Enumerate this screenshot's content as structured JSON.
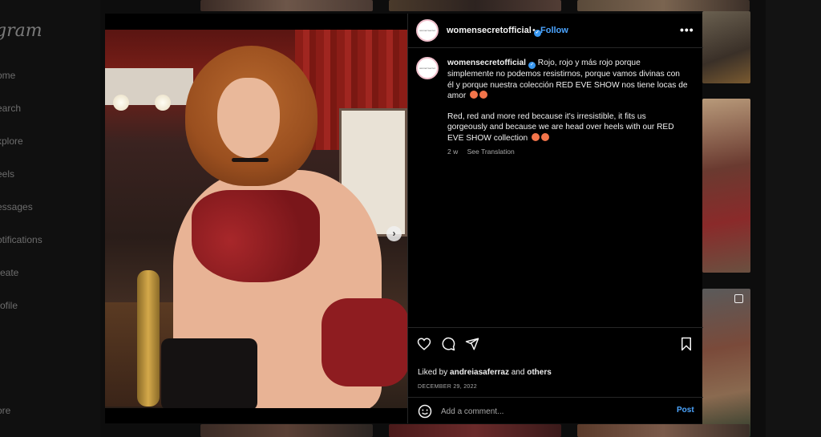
{
  "sidebar": {
    "brand": "gram",
    "items": [
      {
        "label": "ome"
      },
      {
        "label": "earch"
      },
      {
        "label": "xplore"
      },
      {
        "label": "eels"
      },
      {
        "label": "essages"
      },
      {
        "label": "otifications"
      },
      {
        "label": "reate"
      },
      {
        "label": "rofile"
      },
      {
        "label": "ore"
      }
    ]
  },
  "post": {
    "username": "womensecretofficial",
    "avatar_text": "women'secret",
    "separator": "•",
    "follow_label": "Follow",
    "more_label": "•••",
    "caption_es": "Rojo, rojo y más rojo porque simplemente no podemos resistirnos, porque vamos divinas con él y porque nuestra colección RED EVE SHOW nos tiene locas de amor",
    "caption_en": "Red, red and more red because it's irresistible, it fits us gorgeously and because we are head over heels with our RED EVE SHOW collection",
    "time_ago": "2 w",
    "see_translation": "See Translation",
    "liked_by_prefix": "Liked by",
    "liked_by_user": "andreiasaferraz",
    "liked_by_and": "and",
    "liked_by_others": "others",
    "date": "DECEMBER 29, 2022",
    "comment_placeholder": "Add a comment...",
    "post_label": "Post",
    "carousel_next": "›"
  },
  "colors": {
    "accent": "#4ca5ff",
    "verified": "#3897f0",
    "background": "#000000"
  }
}
